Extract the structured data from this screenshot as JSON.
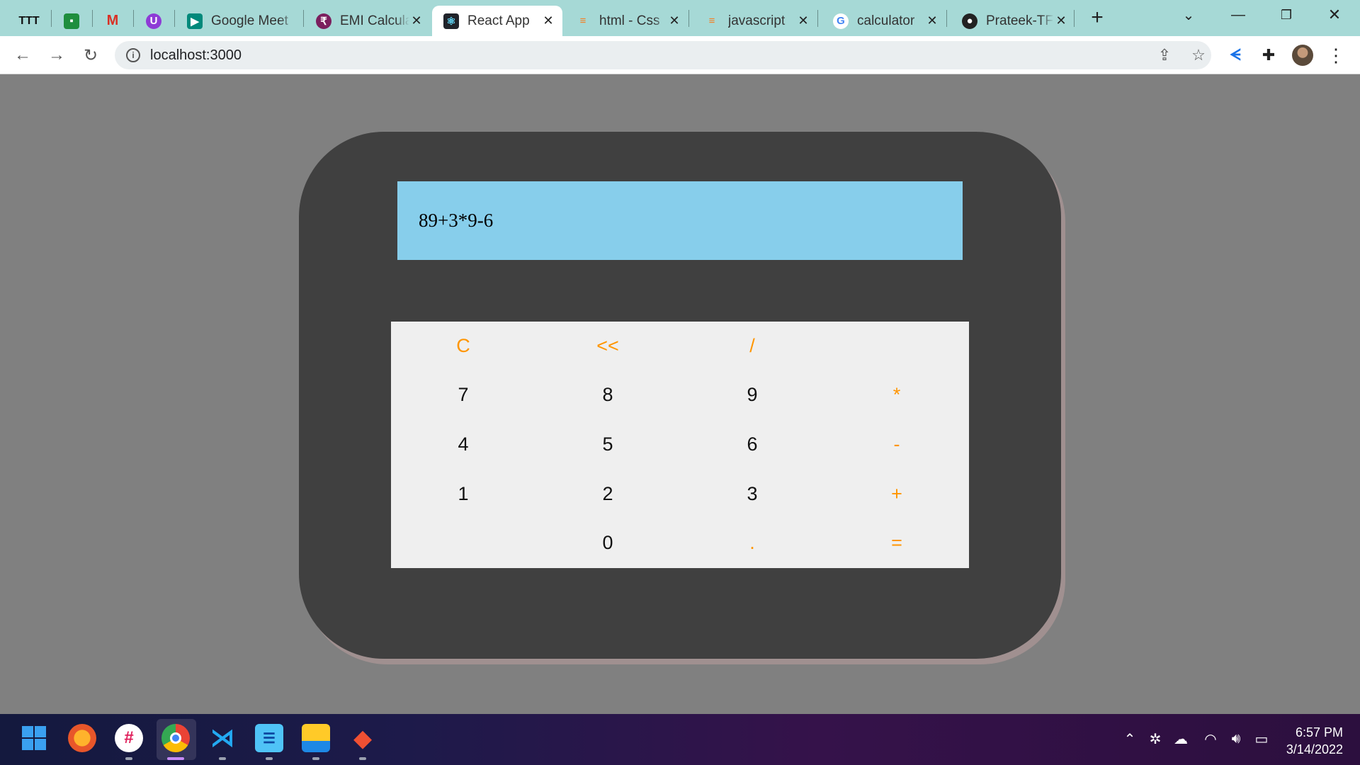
{
  "browser": {
    "tabs": [
      {
        "icon": "tt-icon",
        "title": "",
        "pinned": true
      },
      {
        "icon": "google-chat-icon",
        "title": "",
        "pinned": true
      },
      {
        "icon": "gmail-icon",
        "title": "",
        "pinned": true
      },
      {
        "icon": "u-icon",
        "title": "",
        "pinned": true
      },
      {
        "icon": "google-meet-icon",
        "title": "Google Meet",
        "pinned": false
      },
      {
        "icon": "emi-calculator-icon",
        "title": "EMI Calculator",
        "pinned": false
      },
      {
        "icon": "react-icon",
        "title": "React App",
        "pinned": false,
        "active": true
      },
      {
        "icon": "stackoverflow-icon",
        "title": "html - Css",
        "pinned": false
      },
      {
        "icon": "stackoverflow-icon",
        "title": "javascript",
        "pinned": false
      },
      {
        "icon": "google-icon",
        "title": "calculator",
        "pinned": false
      },
      {
        "icon": "github-icon",
        "title": "Prateek-TF",
        "pinned": false
      }
    ],
    "url": "localhost:3000"
  },
  "calculator": {
    "display": "89+3*9-6",
    "keys": [
      [
        "C",
        "<<",
        "/",
        ""
      ],
      [
        "7",
        "8",
        "9",
        "*"
      ],
      [
        "4",
        "5",
        "6",
        "-"
      ],
      [
        "1",
        "2",
        "3",
        "+"
      ],
      [
        "",
        "0",
        ".",
        "="
      ]
    ],
    "colors": {
      "operator": "#ff9500",
      "display_bg": "#87ceeb",
      "body": "#404040",
      "page_bg": "#808080"
    }
  },
  "taskbar": {
    "apps": [
      "windows-start-icon",
      "firefox-icon",
      "slack-icon",
      "chrome-icon",
      "vscode-icon",
      "notepad-icon",
      "file-explorer-icon",
      "git-icon"
    ],
    "tray_icons": [
      "chevron-up-icon",
      "slack-tray-icon",
      "onedrive-icon",
      "wifi-icon",
      "volume-icon",
      "battery-icon"
    ],
    "time": "6:57 PM",
    "date": "3/14/2022"
  }
}
